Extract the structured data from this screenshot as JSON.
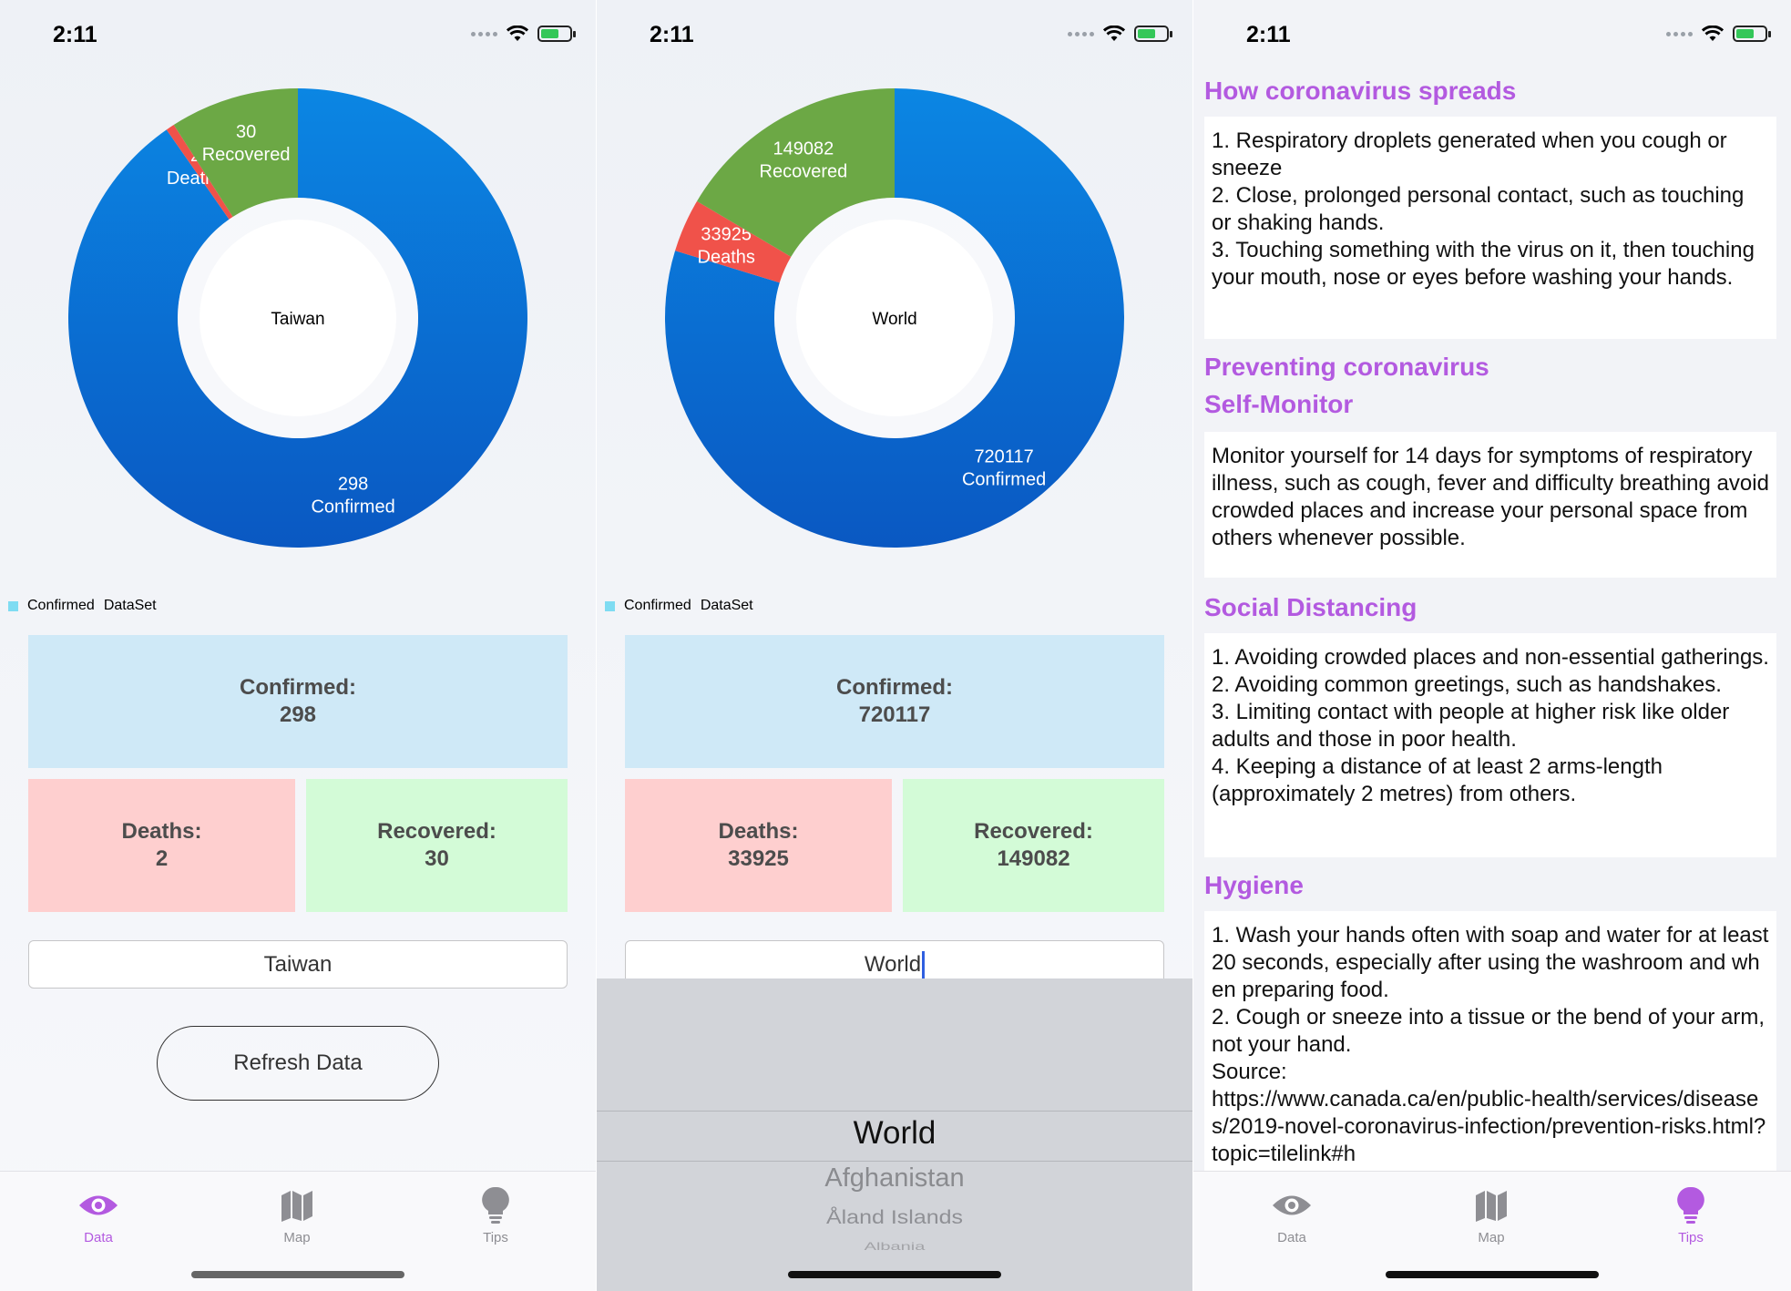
{
  "status": {
    "time": "2:11"
  },
  "colors": {
    "confirmed": "#0a6fd6",
    "deaths": "#f0524a",
    "recovered": "#6ca845",
    "accent": "#b35ae0"
  },
  "screen1": {
    "chart_data": {
      "type": "pie",
      "center_label": "Taiwan",
      "slices": [
        {
          "label": "Confirmed",
          "value": 298
        },
        {
          "label": "Deaths",
          "value": 2
        },
        {
          "label": "Recovered",
          "value": 30
        }
      ],
      "legend": [
        "Confirmed",
        "DataSet"
      ]
    },
    "legend_label": "Confirmed",
    "legend_dataset": "DataSet",
    "confirmed": {
      "label": "Confirmed:",
      "value": "298"
    },
    "deaths": {
      "label": "Deaths:",
      "value": "2"
    },
    "recovered": {
      "label": "Recovered:",
      "value": "30"
    },
    "region_input": "Taiwan",
    "refresh_label": "Refresh Data"
  },
  "screen2": {
    "chart_data": {
      "type": "pie",
      "center_label": "World",
      "slices": [
        {
          "label": "Confirmed",
          "value": 720117
        },
        {
          "label": "Deaths",
          "value": 33925
        },
        {
          "label": "Recovered",
          "value": 149082
        }
      ],
      "legend": [
        "Confirmed",
        "DataSet"
      ]
    },
    "legend_label": "Confirmed",
    "legend_dataset": "DataSet",
    "confirmed": {
      "label": "Confirmed:",
      "value": "720117"
    },
    "deaths": {
      "label": "Deaths:",
      "value": "33925"
    },
    "recovered": {
      "label": "Recovered:",
      "value": "149082"
    },
    "region_input": "World",
    "picker_options": [
      "World",
      "Afghanistan",
      "Åland Islands",
      "Albania"
    ]
  },
  "tabs": {
    "data": "Data",
    "map": "Map",
    "tips": "Tips"
  },
  "tips": {
    "spread_title": "How coronavirus spreads",
    "spread_body": "1. Respiratory droplets generated when you cough or sneeze\n2. Close, prolonged personal contact, such as touching or shaking hands.\n3. Touching something with the virus on it, then touching your mouth, nose or eyes before washing your hands.",
    "prevent_title": "Preventing coronavirus",
    "self_title": "Self-Monitor",
    "self_body": "Monitor yourself for 14 days for symptoms of respiratory illness, such as cough, fever and difficulty breathing avoid crowded places and increase your personal space from others whenever possible.",
    "social_title": "Social Distancing",
    "social_body": "1. Avoiding crowded places and non-essential gatherings.\n2. Avoiding common greetings, such as handshakes.\n3. Limiting contact with people at higher risk like older adults and those in poor health.\n4. Keeping a distance of at least 2 arms-length (approximately 2 metres) from others.",
    "hygiene_title": "Hygiene",
    "hygiene_body": "1. Wash your hands often with soap and water for at least 20 seconds, especially after using the washroom and when preparing food.\n2. Cough or sneeze into a tissue or the bend of your arm, not your hand.\nSource:\nhttps://www.canada.ca/en/public-health/services/diseases/2019-novel-coronavirus-infection/prevention-risks.html?topic=tilelink#h"
  }
}
